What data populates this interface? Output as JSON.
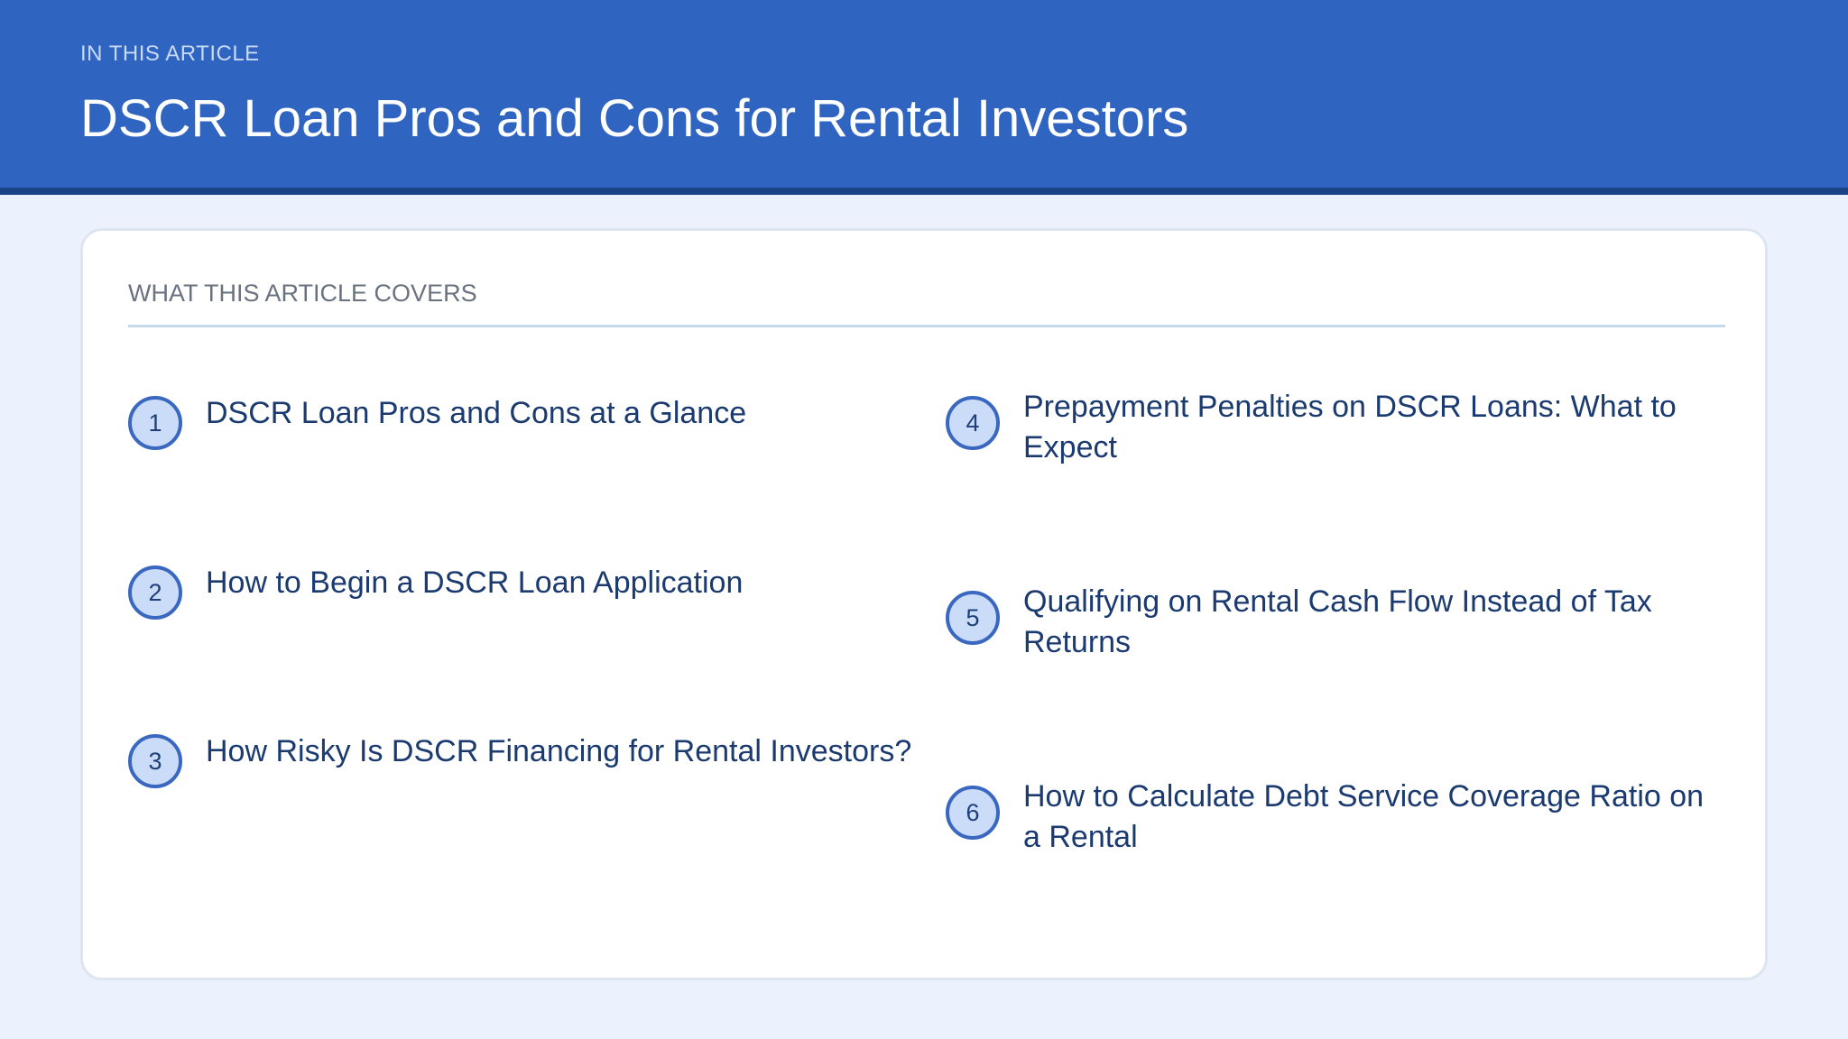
{
  "header": {
    "eyebrow": "IN THIS ARTICLE",
    "title": "DSCR Loan Pros and Cons for Rental Investors"
  },
  "card": {
    "label": "WHAT THIS ARTICLE COVERS",
    "items": [
      {
        "number": "1",
        "text": "DSCR Loan Pros and Cons at a Glance"
      },
      {
        "number": "2",
        "text": "How to Begin a DSCR Loan Application"
      },
      {
        "number": "3",
        "text": "How Risky Is DSCR Financing for Rental Investors?"
      },
      {
        "number": "4",
        "text": "Prepayment Penalties on DSCR Loans: What to Expect"
      },
      {
        "number": "5",
        "text": "Qualifying on Rental Cash Flow Instead of Tax Returns"
      },
      {
        "number": "6",
        "text": "How to Calculate Debt Service Coverage Ratio on a Rental"
      }
    ]
  },
  "colors": {
    "header_bg": "#3064c1",
    "header_border": "#1a4486",
    "page_bg": "#ebf2fd",
    "badge_fill": "#cbdcf9",
    "badge_border": "#3a68c0",
    "item_text": "#1a3a70"
  }
}
